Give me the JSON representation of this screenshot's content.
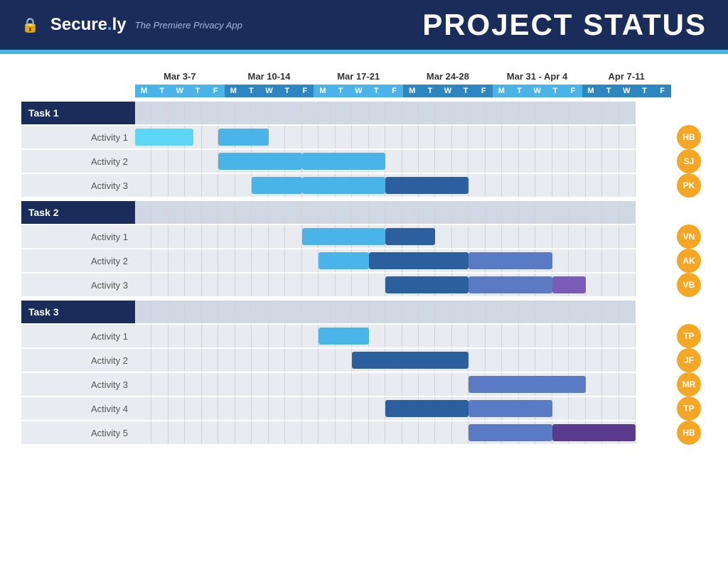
{
  "header": {
    "logo": "Secure.ly",
    "logo_dot": ".",
    "tagline": "The Premiere Privacy App",
    "title": "PROJECT STATUS"
  },
  "weeks": [
    {
      "label": "Mar 3-7",
      "days": [
        "M",
        "T",
        "W",
        "T",
        "F"
      ],
      "style": "cyan"
    },
    {
      "label": "Mar 10-14",
      "days": [
        "M",
        "T",
        "W",
        "T",
        "F"
      ],
      "style": "blue"
    },
    {
      "label": "Mar 17-21",
      "days": [
        "M",
        "T",
        "W",
        "T",
        "F"
      ],
      "style": "cyan"
    },
    {
      "label": "Mar 24-28",
      "days": [
        "M",
        "T",
        "W",
        "T",
        "F"
      ],
      "style": "blue"
    },
    {
      "label": "Mar 31 - Apr 4",
      "days": [
        "M",
        "T",
        "W",
        "T",
        "F"
      ],
      "style": "cyan"
    },
    {
      "label": "Apr 7-11",
      "days": [
        "M",
        "T",
        "W",
        "T",
        "F"
      ],
      "style": "blue"
    }
  ],
  "tasks": [
    {
      "label": "Task 1",
      "activities": [
        {
          "label": "Activity 1",
          "avatar": "HB",
          "color": "orange",
          "bars": [
            {
              "start": 0,
              "width": 3.5,
              "color": "cyan"
            },
            {
              "start": 5,
              "width": 3,
              "color": "light-blue"
            }
          ]
        },
        {
          "label": "Activity 2",
          "avatar": "SJ",
          "color": "orange",
          "bars": [
            {
              "start": 5,
              "width": 5,
              "color": "light-blue"
            },
            {
              "start": 10,
              "width": 5,
              "color": "light-blue"
            }
          ]
        },
        {
          "label": "Activity 3",
          "avatar": "PK",
          "color": "orange",
          "bars": [
            {
              "start": 7,
              "width": 3,
              "color": "light-blue"
            },
            {
              "start": 10,
              "width": 5,
              "color": "light-blue"
            },
            {
              "start": 15,
              "width": 5,
              "color": "dark-blue"
            }
          ]
        }
      ]
    },
    {
      "label": "Task 2",
      "activities": [
        {
          "label": "Activity 1",
          "avatar": "VN",
          "color": "orange",
          "bars": [
            {
              "start": 10,
              "width": 5,
              "color": "light-blue"
            },
            {
              "start": 15,
              "width": 3,
              "color": "dark-blue"
            }
          ]
        },
        {
          "label": "Activity 2",
          "avatar": "AK",
          "color": "orange",
          "bars": [
            {
              "start": 11,
              "width": 3,
              "color": "light-blue"
            },
            {
              "start": 14,
              "width": 6,
              "color": "dark-blue"
            },
            {
              "start": 20,
              "width": 5,
              "color": "purple-blue"
            }
          ]
        },
        {
          "label": "Activity 3",
          "avatar": "VB",
          "color": "orange",
          "bars": [
            {
              "start": 15,
              "width": 5,
              "color": "dark-blue"
            },
            {
              "start": 20,
              "width": 5,
              "color": "purple-blue"
            },
            {
              "start": 25,
              "width": 2,
              "color": "purple"
            }
          ]
        }
      ]
    },
    {
      "label": "Task 3",
      "activities": [
        {
          "label": "Activity 1",
          "avatar": "TP",
          "color": "orange",
          "bars": [
            {
              "start": 11,
              "width": 3,
              "color": "light-blue"
            }
          ]
        },
        {
          "label": "Activity 2",
          "avatar": "JF",
          "color": "orange",
          "bars": [
            {
              "start": 13,
              "width": 7,
              "color": "dark-blue"
            }
          ]
        },
        {
          "label": "Activity 3",
          "avatar": "MR",
          "color": "orange",
          "bars": [
            {
              "start": 20,
              "width": 7,
              "color": "purple-blue"
            }
          ]
        },
        {
          "label": "Activity 4",
          "avatar": "TP",
          "color": "orange",
          "bars": [
            {
              "start": 15,
              "width": 5,
              "color": "dark-blue"
            },
            {
              "start": 20,
              "width": 5,
              "color": "purple-blue"
            }
          ]
        },
        {
          "label": "Activity 5",
          "avatar": "HB",
          "color": "orange",
          "bars": [
            {
              "start": 20,
              "width": 5,
              "color": "purple-blue"
            },
            {
              "start": 25,
              "width": 5,
              "color": "dark-purple"
            }
          ]
        }
      ]
    }
  ]
}
